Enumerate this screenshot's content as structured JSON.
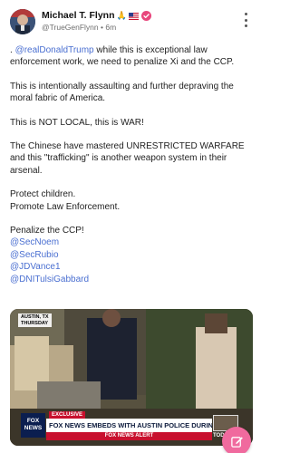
{
  "author": {
    "name": "Michael T. Flynn",
    "emoji": "🙏",
    "handle": "@TrueGenFlynn",
    "time": "6m",
    "separator": "•"
  },
  "post": {
    "p1_prefix": ". ",
    "p1_mention": "@realDonaldTrump",
    "p1_text": " while this is exceptional law enforcement work, we need to penalize Xi and the CCP.",
    "p2": "This is intentionally assaulting and further depraving the moral fabric of America.",
    "p3": "This is NOT LOCAL, this is WAR!",
    "p4": "The Chinese have mastered UNRESTRICTED WARFARE and this \"trafficking\" is another weapon system in their arsenal.",
    "p5_line1": "Protect children.",
    "p5_line2": "Promote Law Enforcement.",
    "p6": "Penalize the CCP!",
    "mentions": [
      "@SecNoem",
      "@SecRubio",
      "@JDVance1",
      "@DNITulsiGabbard"
    ]
  },
  "media": {
    "station_bug_line1": "AUSTIN, TX",
    "station_bug_line2": "THURSDAY",
    "exclusive": "EXCLUSIVE",
    "headline": "FOX NEWS EMBEDS WITH AUSTIN POLICE DURING RAID",
    "alert": "FOX NEWS ALERT",
    "network_line1": "FOX",
    "network_line2": "NEWS",
    "today": "TODAY"
  },
  "colors": {
    "mention": "#4a6fd1",
    "verified": "#e8467c",
    "fab": "#f06a9e",
    "alert_red": "#c8102e"
  },
  "icons": {
    "more": "more-vertical-icon",
    "verified": "verified-badge-icon",
    "compose": "compose-pencil-icon"
  }
}
